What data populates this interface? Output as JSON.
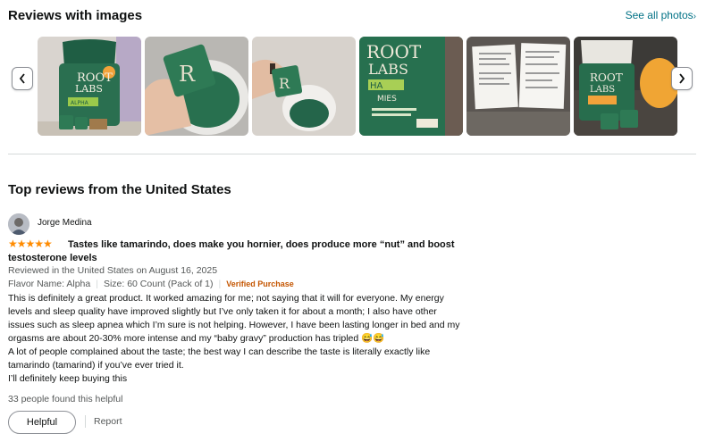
{
  "images_section": {
    "title": "Reviews with images",
    "see_all": "See all photos",
    "prev_icon": "chevron-left-icon",
    "next_icon": "chevron-right-icon",
    "photos": [
      {
        "brand": "ROOT",
        "brand2": "LABS",
        "subtitle": "ALPHA"
      },
      {
        "brand": "R"
      },
      {
        "brand": "R"
      },
      {
        "brand": "ROOT",
        "brand2": "LABS",
        "subtitle": "HA",
        "subtitle2": "MIES"
      },
      {
        "brand": ""
      },
      {
        "brand": "ROOT",
        "brand2": "LABS"
      }
    ]
  },
  "reviews_section": {
    "title": "Top reviews from the United States"
  },
  "review": {
    "reviewer": "Jorge Medina",
    "rating": 5,
    "stars": "★★★★★",
    "headline": "Tastes like tamarindo, does make you hornier, does produce more “nut” and boost testosterone levels",
    "reviewed_in": "Reviewed in the United States on August 16, 2025",
    "flavor": "Flavor Name: Alpha",
    "size": "Size: 60 Count (Pack of 1)",
    "verified": "Verified Purchase",
    "body_lines": [
      "This is definitely a great product. It worked amazing for me; not saying that it will for everyone. My energy",
      "levels and sleep quality have improved slightly but I’ve only taken it for about a month; I also have other",
      "issues such as sleep apnea which I’m sure is not helping. However, I have been lasting longer in bed and my",
      "orgasms are about 20-30% more intense and my “baby gravy” production has tripled 😅😅",
      "A lot of people complained about the taste; the best way I can describe the taste is literally exactly like",
      "tamarindo (tamarind) if you’ve ever tried it.",
      "I’ll definitely keep buying this"
    ],
    "helpful_count": "33 people found this helpful",
    "helpful_button": "Helpful",
    "report_link": "Report"
  }
}
